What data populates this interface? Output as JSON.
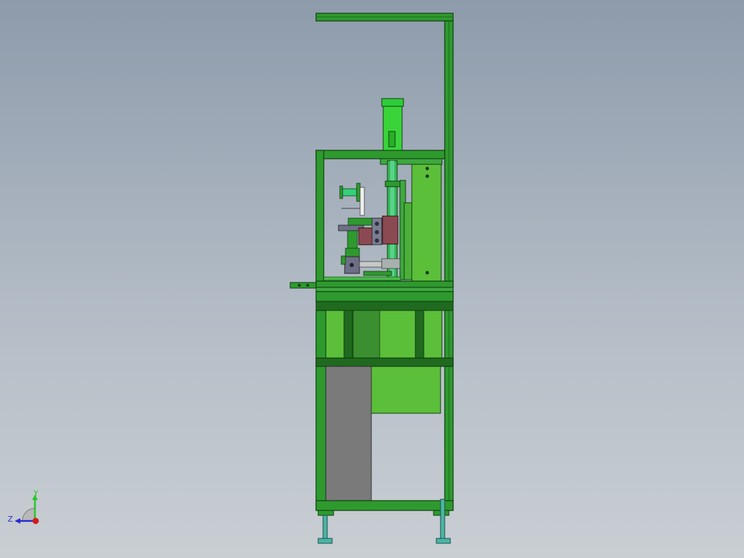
{
  "viewport": {
    "background_top": "#8d9bab",
    "background_bottom": "#c9ced3"
  },
  "model": {
    "colors": {
      "frame": "#2e9a2e",
      "frame_dark": "#1f6a1f",
      "frame_edge": "#0f3d0f",
      "panel": "#5cbf3a",
      "cylinder": "#38d238",
      "shaft": "#34b85a",
      "brown_part": "#8b4a52",
      "slate_part": "#6d6f86",
      "gray_panel": "#7a7a7a",
      "foot": "#4ab5a5"
    }
  },
  "triad": {
    "y_label": "Y",
    "z_label": "Z",
    "y_color": "#2ac42a",
    "z_color": "#2a2acb",
    "x_color": "#d21d1d"
  }
}
